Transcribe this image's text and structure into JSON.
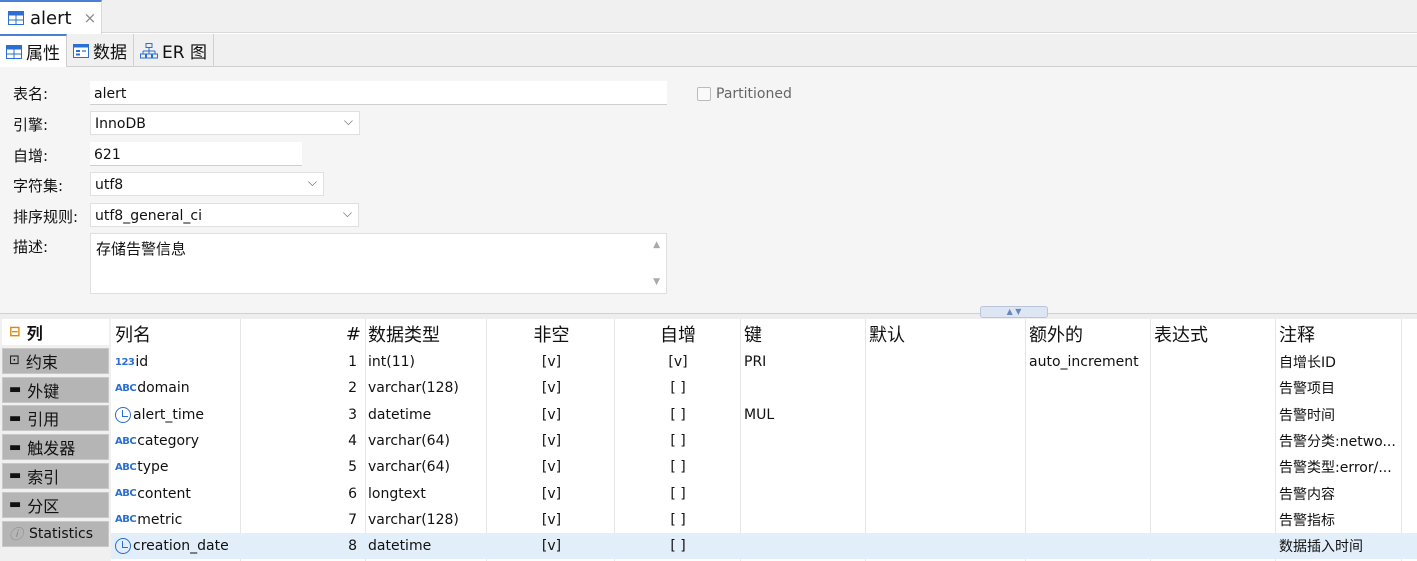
{
  "editor_tab": {
    "title": "alert",
    "close": "×"
  },
  "subtabs": [
    {
      "label": "属性"
    },
    {
      "label": "数据"
    },
    {
      "label": "ER 图"
    }
  ],
  "form": {
    "table_name_label": "表名:",
    "table_name": "alert",
    "partitioned_label": "Partitioned",
    "engine_label": "引擎:",
    "engine": "InnoDB",
    "auto_inc_label": "自增:",
    "auto_inc": "621",
    "charset_label": "字符集:",
    "charset": "utf8",
    "collation_label": "排序规则:",
    "collation": "utf8_general_ci",
    "desc_label": "描述:",
    "desc": "存储告警信息"
  },
  "nav": [
    {
      "label": "列",
      "icon": "column-add-icon"
    },
    {
      "label": "约束",
      "icon": "constraint-icon"
    },
    {
      "label": "外键",
      "icon": "folder-icon"
    },
    {
      "label": "引用",
      "icon": "folder-icon"
    },
    {
      "label": "触发器",
      "icon": "folder-icon"
    },
    {
      "label": "索引",
      "icon": "folder-icon"
    },
    {
      "label": "分区",
      "icon": "folder-icon"
    },
    {
      "label": "Statistics",
      "icon": "info-icon"
    }
  ],
  "grid": {
    "headers": [
      "列名",
      "#",
      "数据类型",
      "非空",
      "自增",
      "键",
      "默认",
      "额外的",
      "表达式",
      "注释"
    ],
    "rows": [
      {
        "icon": "123",
        "name": "id",
        "num": "1",
        "type": "int(11)",
        "notnull": "[v]",
        "autoinc": "[v]",
        "key": "PRI",
        "default": "",
        "extra": "auto_increment",
        "expr": "",
        "comment": "自增长ID"
      },
      {
        "icon": "ABC",
        "name": "domain",
        "num": "2",
        "type": "varchar(128)",
        "notnull": "[v]",
        "autoinc": "[ ]",
        "key": "",
        "default": "",
        "extra": "",
        "expr": "",
        "comment": "告警项目"
      },
      {
        "icon": "clock",
        "name": "alert_time",
        "num": "3",
        "type": "datetime",
        "notnull": "[v]",
        "autoinc": "[ ]",
        "key": "MUL",
        "default": "",
        "extra": "",
        "expr": "",
        "comment": "告警时间"
      },
      {
        "icon": "ABC",
        "name": "category",
        "num": "4",
        "type": "varchar(64)",
        "notnull": "[v]",
        "autoinc": "[ ]",
        "key": "",
        "default": "",
        "extra": "",
        "expr": "",
        "comment": "告警分类:netwo..."
      },
      {
        "icon": "ABC",
        "name": "type",
        "num": "5",
        "type": "varchar(64)",
        "notnull": "[v]",
        "autoinc": "[ ]",
        "key": "",
        "default": "",
        "extra": "",
        "expr": "",
        "comment": "告警类型:error/..."
      },
      {
        "icon": "ABC",
        "name": "content",
        "num": "6",
        "type": "longtext",
        "notnull": "[v]",
        "autoinc": "[ ]",
        "key": "",
        "default": "",
        "extra": "",
        "expr": "",
        "comment": "告警内容"
      },
      {
        "icon": "ABC",
        "name": "metric",
        "num": "7",
        "type": "varchar(128)",
        "notnull": "[v]",
        "autoinc": "[ ]",
        "key": "",
        "default": "",
        "extra": "",
        "expr": "",
        "comment": "告警指标"
      },
      {
        "icon": "clock",
        "name": "creation_date",
        "num": "8",
        "type": "datetime",
        "notnull": "[v]",
        "autoinc": "[ ]",
        "key": "",
        "default": "",
        "extra": "",
        "expr": "",
        "comment": "数据插入时间"
      }
    ]
  },
  "colors": {
    "accent": "#4a7fd6",
    "selected_row": "#e2eef9",
    "type_icon": "#2a6fd1"
  }
}
